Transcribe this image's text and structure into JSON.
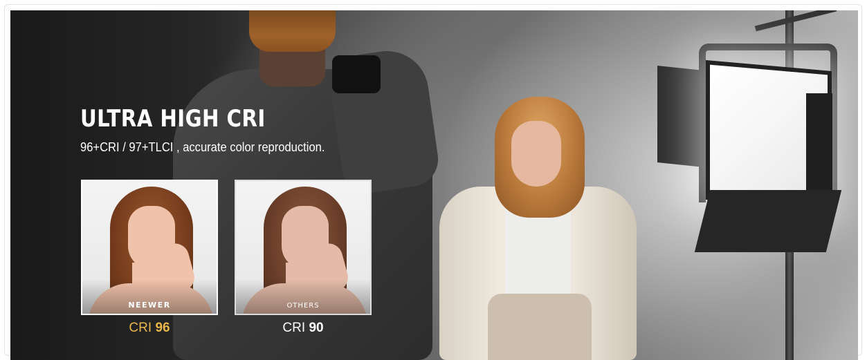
{
  "banner": {
    "headline": "ULTRA HIGH CRI",
    "subline": "96+CRI / 97+TLCI , accurate color reproduction."
  },
  "comparison": [
    {
      "brand_label": "NEEWER",
      "cri_prefix": "CRI",
      "cri_value": "96",
      "accent_color": "#e8b64a"
    },
    {
      "brand_label": "OTHERS",
      "cri_prefix": "CRI",
      "cri_value": "90",
      "accent_color": "#ffffff"
    }
  ]
}
